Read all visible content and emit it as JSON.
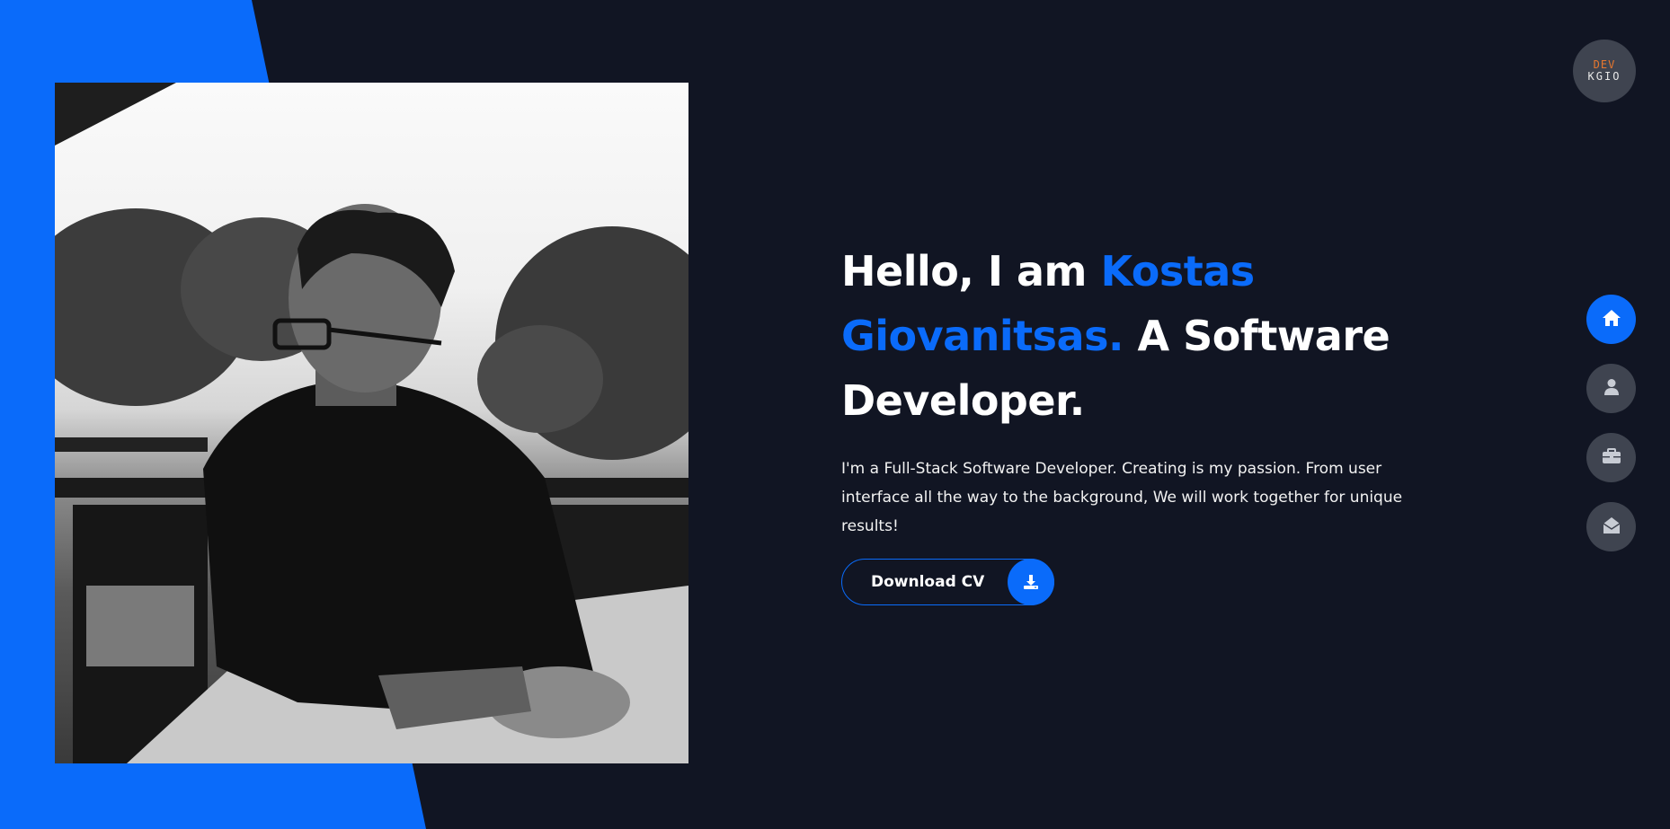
{
  "logo": {
    "line1": "DEV",
    "line2": "KGIO"
  },
  "hero": {
    "title_prefix": "Hello, I am ",
    "title_name": "Kostas Giovanitsas.",
    "title_suffix": " A Software Developer.",
    "description": "I'm a Full-Stack Software Developer. Creating is my passion. From user interface all the way to the background, We will work together for unique results!",
    "cv_button_label": "Download CV"
  },
  "nav": {
    "items": [
      {
        "name": "home",
        "icon": "home-icon",
        "active": true
      },
      {
        "name": "about",
        "icon": "user-icon",
        "active": false
      },
      {
        "name": "portfolio",
        "icon": "briefcase-icon",
        "active": false
      },
      {
        "name": "contact",
        "icon": "envelope-open-icon",
        "active": false
      }
    ]
  },
  "colors": {
    "background": "#111523",
    "accent": "#0a6bfa",
    "nav_inactive": "#3f4450",
    "logo_accent": "#e8772e",
    "text": "#ffffff"
  }
}
